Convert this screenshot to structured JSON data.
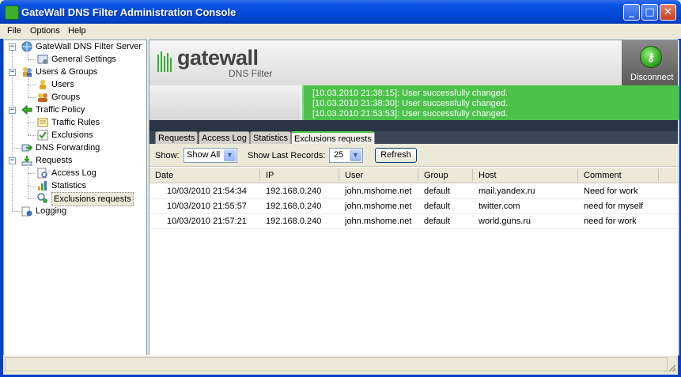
{
  "window": {
    "title": "GateWall DNS Filter Administration Console",
    "minimize_glyph": "_",
    "maximize_glyph": "□",
    "close_glyph": "✕"
  },
  "menu": [
    "File",
    "Options",
    "Help"
  ],
  "tree": {
    "server": "GateWall DNS Filter Server",
    "general_settings": "General Settings",
    "users_groups": "Users & Groups",
    "users": "Users",
    "groups": "Groups",
    "traffic_policy": "Traffic Policy",
    "traffic_rules": "Traffic Rules",
    "exclusions": "Exclusions",
    "dns_forwarding": "DNS Forwarding",
    "requests": "Requests",
    "access_log": "Access Log",
    "statistics": "Statistics",
    "exclusions_requests": "Exclusions requests",
    "logging": "Logging",
    "expanded_glyph": "−"
  },
  "header": {
    "logo": "gatewall",
    "subtitle": "DNS Filter",
    "disconnect_label": "Disconnect"
  },
  "messages": [
    "[10.03.2010 21:38:15]: User successfully changed.",
    "[10.03.2010 21:38:30]: User successfully changed.",
    "[10.03.2010 21:53:53]: User successfully changed."
  ],
  "tabs": [
    "Requests",
    "Access Log",
    "Statistics",
    "Exclusions requests"
  ],
  "active_tab": "Exclusions requests",
  "toolbar": {
    "show_label": "Show:",
    "show_value": "Show All",
    "last_label": "Show Last Records:",
    "last_value": "25",
    "refresh_label": "Refresh",
    "dropdown_glyph": "▼"
  },
  "table": {
    "columns": [
      "Date",
      "IP",
      "User",
      "Group",
      "Host",
      "Comment"
    ],
    "rows": [
      [
        "10/03/2010 21:54:34",
        "192.168.0.240",
        "john.mshome.net",
        "default",
        "mail.yandex.ru",
        "Need for work"
      ],
      [
        "10/03/2010 21:55:57",
        "192.168.0.240",
        "john.mshome.net",
        "default",
        "twitter.com",
        "need for myself"
      ],
      [
        "10/03/2010 21:57:21",
        "192.168.0.240",
        "john.mshome.net",
        "default",
        "world.guns.ru",
        "need for work"
      ]
    ]
  },
  "colors": {
    "titlebar": "#0049d9",
    "accent_green": "#4cc24a",
    "panel_bg": "#ece9d8"
  }
}
